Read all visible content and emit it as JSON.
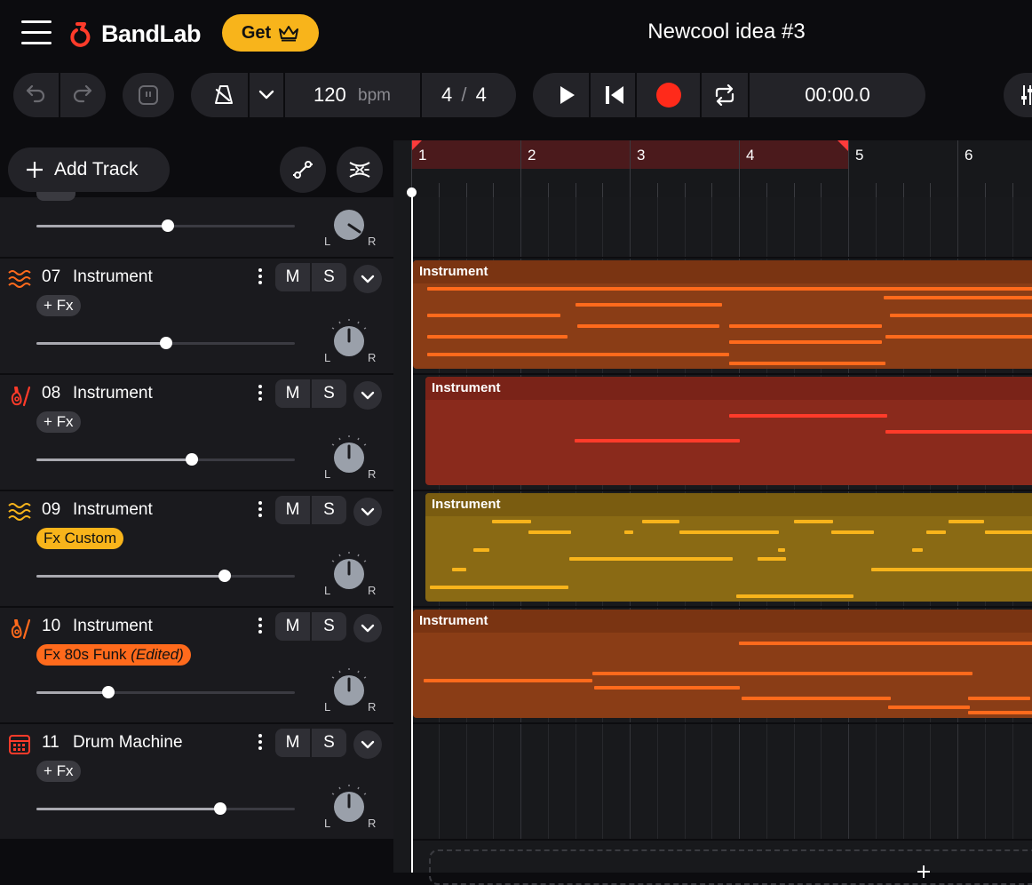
{
  "app": {
    "logo_text": "BandLab",
    "get_label": "Get",
    "project_title": "Newcool idea #3",
    "colors": {
      "accent_yellow": "#f8b41b",
      "record_red": "#ff2a1a",
      "bg": "#0c0c0f"
    }
  },
  "toolbar": {
    "bpm_value": "120",
    "bpm_unit": "bpm",
    "time_sig_top": "4",
    "time_sig_sep": "/",
    "time_sig_bottom": "4",
    "time_display": "00:00.0",
    "icons": [
      "undo-icon",
      "redo-icon",
      "pause-icon",
      "metronome-icon",
      "chevron-down-icon",
      "play-icon",
      "skip-back-icon",
      "record-icon",
      "loop-icon",
      "mixer-icon"
    ]
  },
  "tracks_panel": {
    "add_track_label": "Add Track",
    "tracks": [
      {
        "num": "07",
        "name": "Instrument",
        "fx": "+ Fx",
        "fx_style": "gray",
        "volume": 0.5,
        "icon": "waves-icon",
        "icon_color": "#ff6a1c"
      },
      {
        "num": "08",
        "name": "Instrument",
        "fx": "+ Fx",
        "fx_style": "gray",
        "volume": 0.6,
        "icon": "guitar-icon",
        "icon_color": "#ff3b2a"
      },
      {
        "num": "09",
        "name": "Instrument",
        "fx": "Fx Custom",
        "fx_style": "yellow",
        "volume": 0.73,
        "icon": "waves-icon",
        "icon_color": "#f8b41b"
      },
      {
        "num": "10",
        "name": "Instrument",
        "fx": "Fx 80s Funk",
        "fx_edited": "(Edited)",
        "fx_style": "orange",
        "volume": 0.28,
        "icon": "guitar-icon",
        "icon_color": "#ff6a1c"
      },
      {
        "num": "11",
        "name": "Drum Machine",
        "fx": "+ Fx",
        "fx_style": "gray",
        "volume": 0.71,
        "icon": "drum-machine-icon",
        "icon_color": "#ff3b2a"
      }
    ],
    "mute_label": "M",
    "solo_label": "S",
    "pan_left": "L",
    "pan_right": "R"
  },
  "timeline": {
    "bars": [
      "1",
      "2",
      "3",
      "4",
      "5",
      "6"
    ],
    "regions": [
      {
        "title": "Instrument",
        "color": "#8a3d16",
        "head": "#7a3412",
        "note": "#ff6a1c"
      },
      {
        "title": "Instrument",
        "color": "#8a2a1c",
        "head": "#7a2318",
        "note": "#ff3b2a"
      },
      {
        "title": "Instrument",
        "color": "#8a6a14",
        "head": "#7a5c10",
        "note": "#f8b41b"
      },
      {
        "title": "Instrument",
        "color": "#8a3d16",
        "head": "#7a3412",
        "note": "#ff6a1c"
      }
    ]
  }
}
